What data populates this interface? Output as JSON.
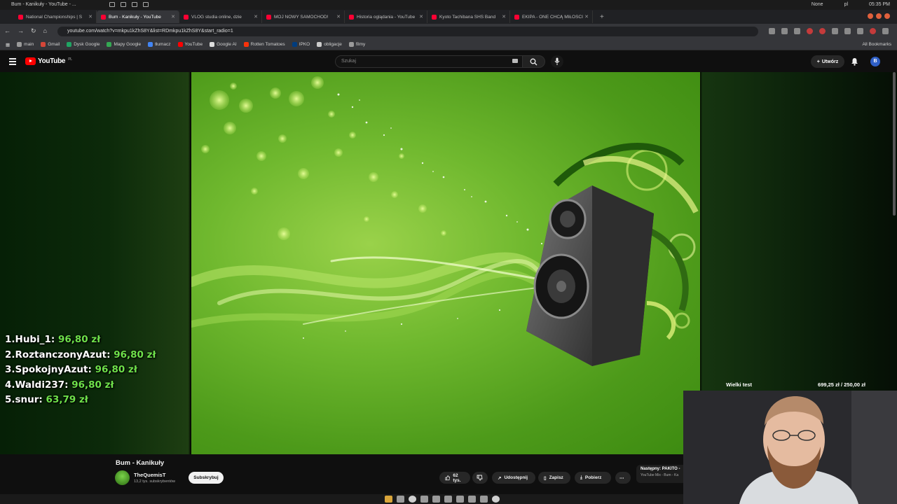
{
  "os": {
    "window_title": "Bum - Kanikuły - YouTube - ...",
    "right_items": [
      "None",
      "pl",
      "05:35 PM"
    ]
  },
  "tabs": [
    {
      "label": "National Championships | S",
      "active": false
    },
    {
      "label": "Bum - Kanikuły - YouTube",
      "active": true
    },
    {
      "label": "VLOG studia online, dzie",
      "active": false
    },
    {
      "label": "MÓJ NOWY SAMOCHÓD!",
      "active": false
    },
    {
      "label": "Historia oglądania - YouTube",
      "active": false
    },
    {
      "label": "Kyoto Tachibana SHS Band",
      "active": false
    },
    {
      "label": "EKIPA - ONE CHCĄ MIŁOŚCI",
      "active": false
    }
  ],
  "address": {
    "url": "youtube.com/watch?v=mkpu1kZhS8Y&list=RDmkpu1kZhS8Y&start_radio=1"
  },
  "bookmarks": [
    {
      "label": "main",
      "color": "#9a9a9a"
    },
    {
      "label": "Gmail",
      "color": "#d44638"
    },
    {
      "label": "Dysk Google",
      "color": "#1fa463"
    },
    {
      "label": "Mapy Google",
      "color": "#34a853"
    },
    {
      "label": "tłumacz",
      "color": "#4285f4"
    },
    {
      "label": "YouTube",
      "color": "#ff0000"
    },
    {
      "label": "Google AI",
      "color": "#dddddd"
    },
    {
      "label": "Rotten Tomatoes",
      "color": "#fa320a"
    },
    {
      "label": "IPKO",
      "color": "#003c7d"
    },
    {
      "label": "obligacje",
      "color": "#cccccc"
    },
    {
      "label": "filmy",
      "color": "#9a9a9a"
    }
  ],
  "bookmarks_all": "All Bookmarks",
  "yt": {
    "logo": "YouTube",
    "region": "PL",
    "search_placeholder": "Szukaj",
    "create_label": "Utwórz",
    "avatar_letter": "B"
  },
  "leaderboard": [
    {
      "name": "1.Hubi_1:",
      "amount": "96,80 zł"
    },
    {
      "name": "2.RoztanczonyAzut:",
      "amount": "96,80 zł"
    },
    {
      "name": "3.SpokojnyAzut:",
      "amount": "96,80 zł"
    },
    {
      "name": "4.Waldi237:",
      "amount": "96,80 zł"
    },
    {
      "name": "5.snur:",
      "amount": "63,79 zł"
    }
  ],
  "widget": {
    "label": "Wielki test",
    "value": "699,25 zł / 250,00 zł"
  },
  "video": {
    "title": "Bum - Kanikuły",
    "channel": "TheQuemisT",
    "subscribers": "13,2 tys. subskrybentów",
    "subscribe_label": "Subskrybuj",
    "likes": "62 tys.",
    "share_label": "Udostępnij",
    "save_label": "Zapisz",
    "download_label": "Pobierz",
    "next_label": "Następny: PAKITO -",
    "next_sub": "YouTube Mix - Bum - Ka"
  },
  "colors": {
    "accent": "#ff0000",
    "amount_green": "#6ee14a",
    "video_green": "#6fb82e"
  }
}
